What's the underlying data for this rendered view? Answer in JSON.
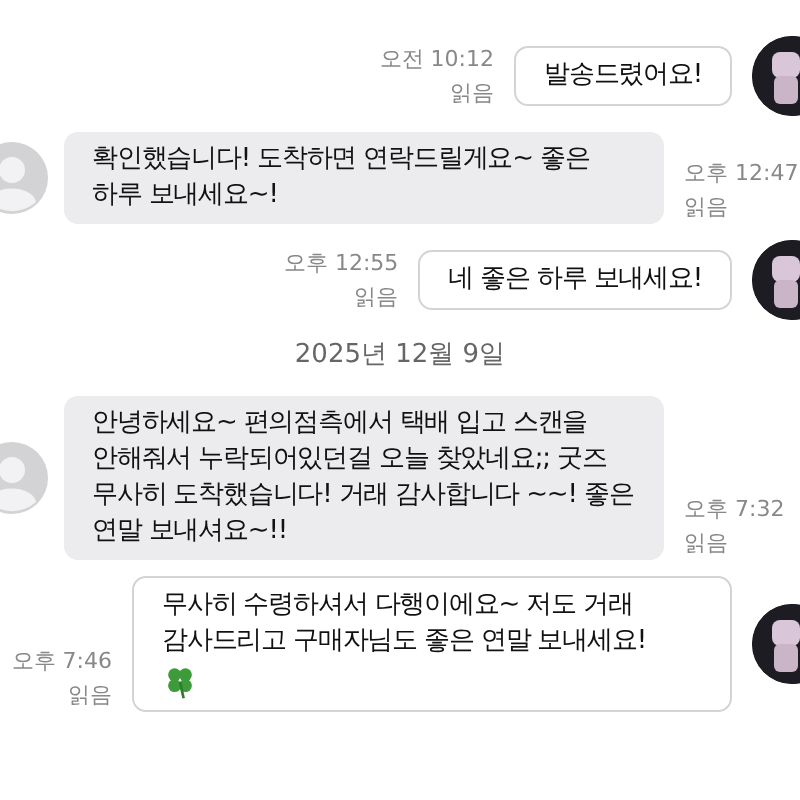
{
  "messages": [
    {
      "kind": "sent",
      "text": "발송드렸어요!",
      "time": "오전 10:12",
      "read": "읽음"
    },
    {
      "kind": "received",
      "text": "확인했습니다! 도착하면 연락드릴게요~ 좋은 하루 보내세요~!",
      "time": "오후 12:47",
      "read": "읽음"
    },
    {
      "kind": "sent",
      "text": "네 좋은 하루 보내세요!",
      "time": "오후 12:55",
      "read": "읽음"
    },
    {
      "kind": "date",
      "text": "2025년 12월 9일"
    },
    {
      "kind": "received",
      "text": "안녕하세요~ 편의점측에서 택배 입고 스캔을 안해줘서 누락되어있던걸 오늘 찾았네요;; 굿즈 무사히 도착했습니다! 거래 감사합니다 ~~! 좋은 연말 보내셔요~!!",
      "time": "오후 7:32",
      "read": "읽음"
    },
    {
      "kind": "sent",
      "text": "무사히 수령하셔서 다행이에요~ 저도 거래 감사드리고 구매자님도 좋은 연말 보내세요!",
      "time": "오후 7:46",
      "read": "읽음",
      "clover": true
    }
  ]
}
